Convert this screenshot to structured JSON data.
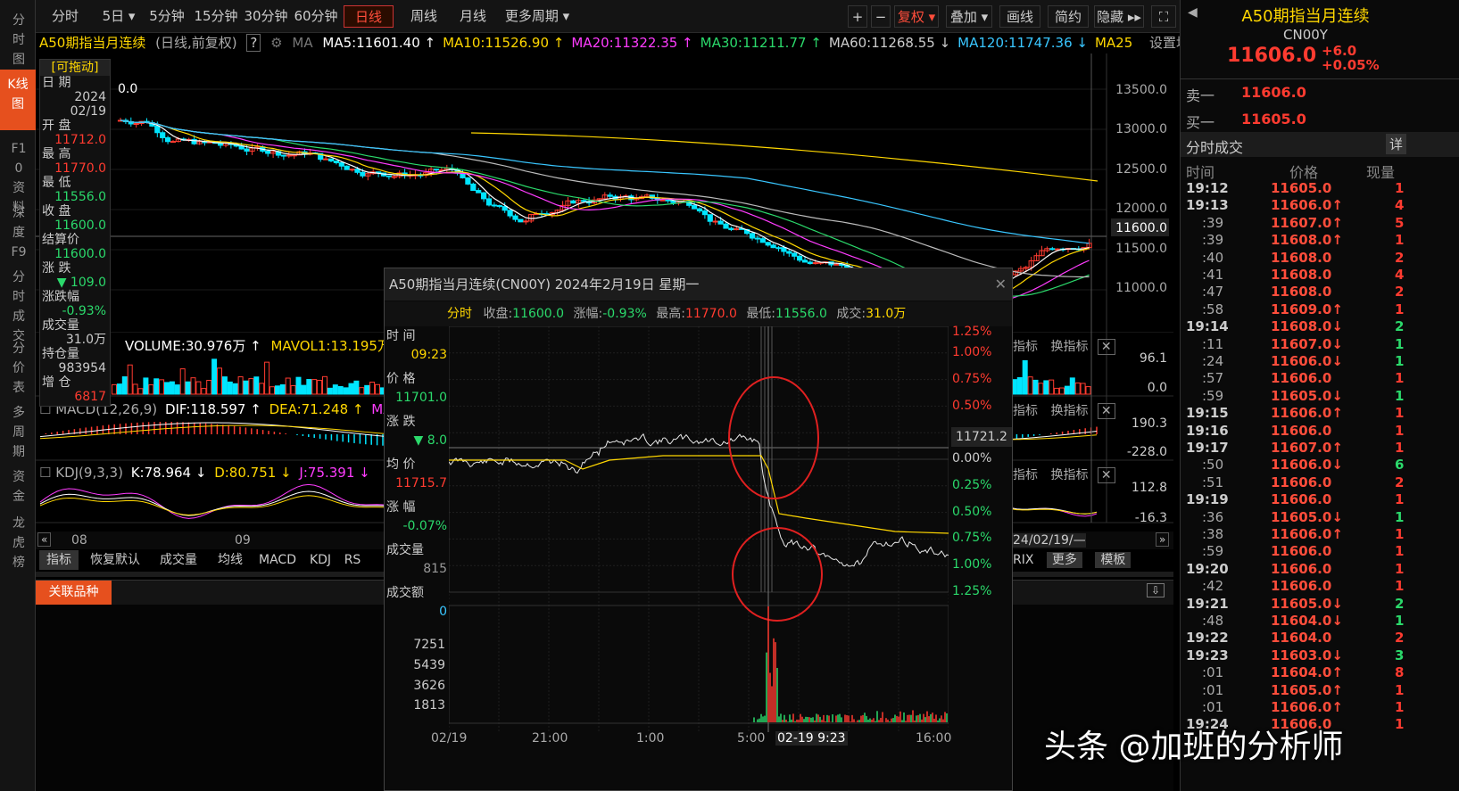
{
  "leftnav": [
    "分时图",
    "K线图",
    "F10资料",
    "深度F9",
    "分时成交",
    "分价表",
    "多周期",
    "资金",
    "龙虎榜"
  ],
  "toolbar": {
    "items": [
      "分时",
      "5日 ▾",
      "5分钟",
      "15分钟",
      "30分钟",
      "60分钟",
      "日线",
      "周线",
      "月线",
      "更多周期 ▾"
    ],
    "active_index": 6,
    "right": [
      "+",
      "−",
      "复权 ▾",
      "叠加 ▾",
      "画线",
      "简约",
      "隐藏 ▸▸",
      "⛶"
    ]
  },
  "maline": {
    "name": "A50期指当月连续",
    "mode": "(日线,前复权)",
    "q": "?",
    "ma": "MA",
    "items": [
      {
        "t": "MA5:11601.40 ↑",
        "c": "#ffffff"
      },
      {
        "t": "MA10:11526.90 ↑",
        "c": "#ffd700"
      },
      {
        "t": "MA20:11322.35 ↑",
        "c": "#ff3cff"
      },
      {
        "t": "MA30:11211.77 ↑",
        "c": "#2bd96b"
      },
      {
        "t": "MA60:11268.55 ↓",
        "c": "#cccccc"
      },
      {
        "t": "MA120:11747.36 ↓",
        "c": "#39c6ff"
      },
      {
        "t": "MA25",
        "c": "#ffd700"
      }
    ],
    "setting": "设置均线 ▾"
  },
  "chart_data": {
    "type": "candlestick",
    "yticks": [
      "13500.0",
      "13000.0",
      "12500.0",
      "12000.0",
      "11600.0",
      "11500.0",
      "11000.0"
    ],
    "xlabels": [
      "08",
      "09",
      "24/02/19/—"
    ],
    "last": "11600.0"
  },
  "datapanel": {
    "drag": "[可拖动]",
    "rows": [
      {
        "l": "日 期",
        "v": "2024"
      },
      {
        "l": "",
        "v": "02/19"
      },
      {
        "l": "开 盘",
        "v": "11712.0",
        "c": "up"
      },
      {
        "l": "最 高",
        "v": "11770.0",
        "c": "up"
      },
      {
        "l": "最 低",
        "v": "11556.0",
        "c": "dn"
      },
      {
        "l": "收 盘",
        "v": "11600.0",
        "c": "dn"
      },
      {
        "l": "结算价",
        "v": "11600.0",
        "c": "dn"
      },
      {
        "l": "涨 跌",
        "v": "▼ 109.0",
        "c": "dn"
      },
      {
        "l": "涨跌幅",
        "v": "-0.93%",
        "c": "dn"
      },
      {
        "l": "成交量",
        "v": "31.0万"
      },
      {
        "l": "持仓量",
        "v": "983954"
      },
      {
        "l": "增 仓",
        "v": "6817",
        "c": "up"
      }
    ]
  },
  "volume": {
    "label": "VOLUME:30.976万 ↑",
    "mavol": "MAVOL1:13.195万 ↑",
    "ticks": [
      "96.1",
      "0.0"
    ]
  },
  "macd": {
    "label": "MACD(12,26,9)",
    "dif": "DIF:118.597 ↑",
    "dea": "DEA:71.248 ↑",
    "macd": "MACD:",
    "ticks": [
      "190.3",
      "-228.0"
    ]
  },
  "kdj": {
    "label": "KDJ(9,3,3)",
    "k": "K:78.964 ↓",
    "d": "D:80.751 ↓",
    "j": "J:75.391 ↓",
    "ticks": [
      "112.8",
      "-16.3"
    ]
  },
  "subtabs": [
    "指标",
    "换指标"
  ],
  "bottomtabs": [
    "指标",
    "恢复默认",
    "成交量",
    "均线",
    "MACD",
    "KDJ",
    "RS"
  ],
  "bottomright": [
    "RIX",
    "更多",
    "模板"
  ],
  "related": "关联品种",
  "popup": {
    "title": "A50期指当月连续(CN00Y) 2024年2月19日 星期一",
    "info": {
      "mode": "分时",
      "close_l": "收盘:",
      "close": "11600.0",
      "chg_l": "涨幅:",
      "chg": "-0.93%",
      "high_l": "最高:",
      "high": "11770.0",
      "low_l": "最低:",
      "low": "11556.0",
      "vol_l": "成交:",
      "vol": "31.0万"
    },
    "labels": [
      {
        "l": "时 间",
        "v": "09:23",
        "c": "#ffd700"
      },
      {
        "l": "价 格",
        "v": "11701.0",
        "c": "#2bd96b"
      },
      {
        "l": "涨 跌",
        "v": "▼ 8.0",
        "c": "#2bd96b"
      },
      {
        "l": "均 价",
        "v": "11715.7",
        "c": "#ff3b30"
      },
      {
        "l": "涨 幅",
        "v": "-0.07%",
        "c": "#2bd96b"
      },
      {
        "l": "成交量",
        "v": "815",
        "c": "#999"
      },
      {
        "l": "成交额",
        "v": "0",
        "c": "#39c6ff"
      }
    ],
    "pct_ticks": [
      "1.25%",
      "1.00%",
      "0.75%",
      "0.50%",
      "0.00%",
      "0.25%",
      "0.50%",
      "0.75%",
      "1.00%",
      "1.25%"
    ],
    "cross_price": "11721.2",
    "vol_ticks": [
      "7251",
      "5439",
      "3626",
      "1813"
    ],
    "xlabels": [
      "02/19",
      "21:00",
      "1:00",
      "5:00",
      "02-19 9:23",
      "16:00"
    ]
  },
  "right": {
    "title": "A50期指当月连续",
    "code": "CN00Y",
    "price": "11606.0",
    "chg": "+6.0",
    "pct": "+0.05%",
    "sell_l": "卖一",
    "sell": "11606.0",
    "buy_l": "买一",
    "buy": "11605.0",
    "section": "分时成交",
    "detail": "详",
    "cols": [
      "时间",
      "价格",
      "现量"
    ],
    "rows": [
      [
        "19:12",
        "11605.0",
        "1"
      ],
      [
        "19:13",
        "11606.0↑",
        "4"
      ],
      [
        ":39",
        "11607.0↑",
        "5"
      ],
      [
        ":39",
        "11608.0↑",
        "1"
      ],
      [
        ":40",
        "11608.0",
        "2"
      ],
      [
        ":41",
        "11608.0",
        "4"
      ],
      [
        ":47",
        "11608.0",
        "2"
      ],
      [
        ":58",
        "11609.0↑",
        "1"
      ],
      [
        "19:14",
        "11608.0↓",
        "2"
      ],
      [
        ":11",
        "11607.0↓",
        "1"
      ],
      [
        ":24",
        "11606.0↓",
        "1"
      ],
      [
        ":57",
        "11606.0",
        "1"
      ],
      [
        ":59",
        "11605.0↓",
        "1"
      ],
      [
        "19:15",
        "11606.0↑",
        "1"
      ],
      [
        "19:16",
        "11606.0",
        "1"
      ],
      [
        "19:17",
        "11607.0↑",
        "1"
      ],
      [
        ":50",
        "11606.0↓",
        "6"
      ],
      [
        ":51",
        "11606.0",
        "2"
      ],
      [
        "19:19",
        "11606.0",
        "1"
      ],
      [
        ":36",
        "11605.0↓",
        "1"
      ],
      [
        ":38",
        "11606.0↑",
        "1"
      ],
      [
        ":59",
        "11606.0",
        "1"
      ],
      [
        "19:20",
        "11606.0",
        "1"
      ],
      [
        ":42",
        "11606.0",
        "1"
      ],
      [
        "19:21",
        "11605.0↓",
        "2"
      ],
      [
        ":48",
        "11604.0↓",
        "1"
      ],
      [
        "19:22",
        "11604.0",
        "2"
      ],
      [
        "19:23",
        "11603.0↓",
        "3"
      ],
      [
        ":01",
        "11604.0↑",
        "8"
      ],
      [
        ":01",
        "11605.0↑",
        "1"
      ],
      [
        ":01",
        "11606.0↑",
        "1"
      ],
      [
        "19:24",
        "11606.0",
        "1"
      ]
    ]
  },
  "watermark": "头条 @加班的分析师"
}
